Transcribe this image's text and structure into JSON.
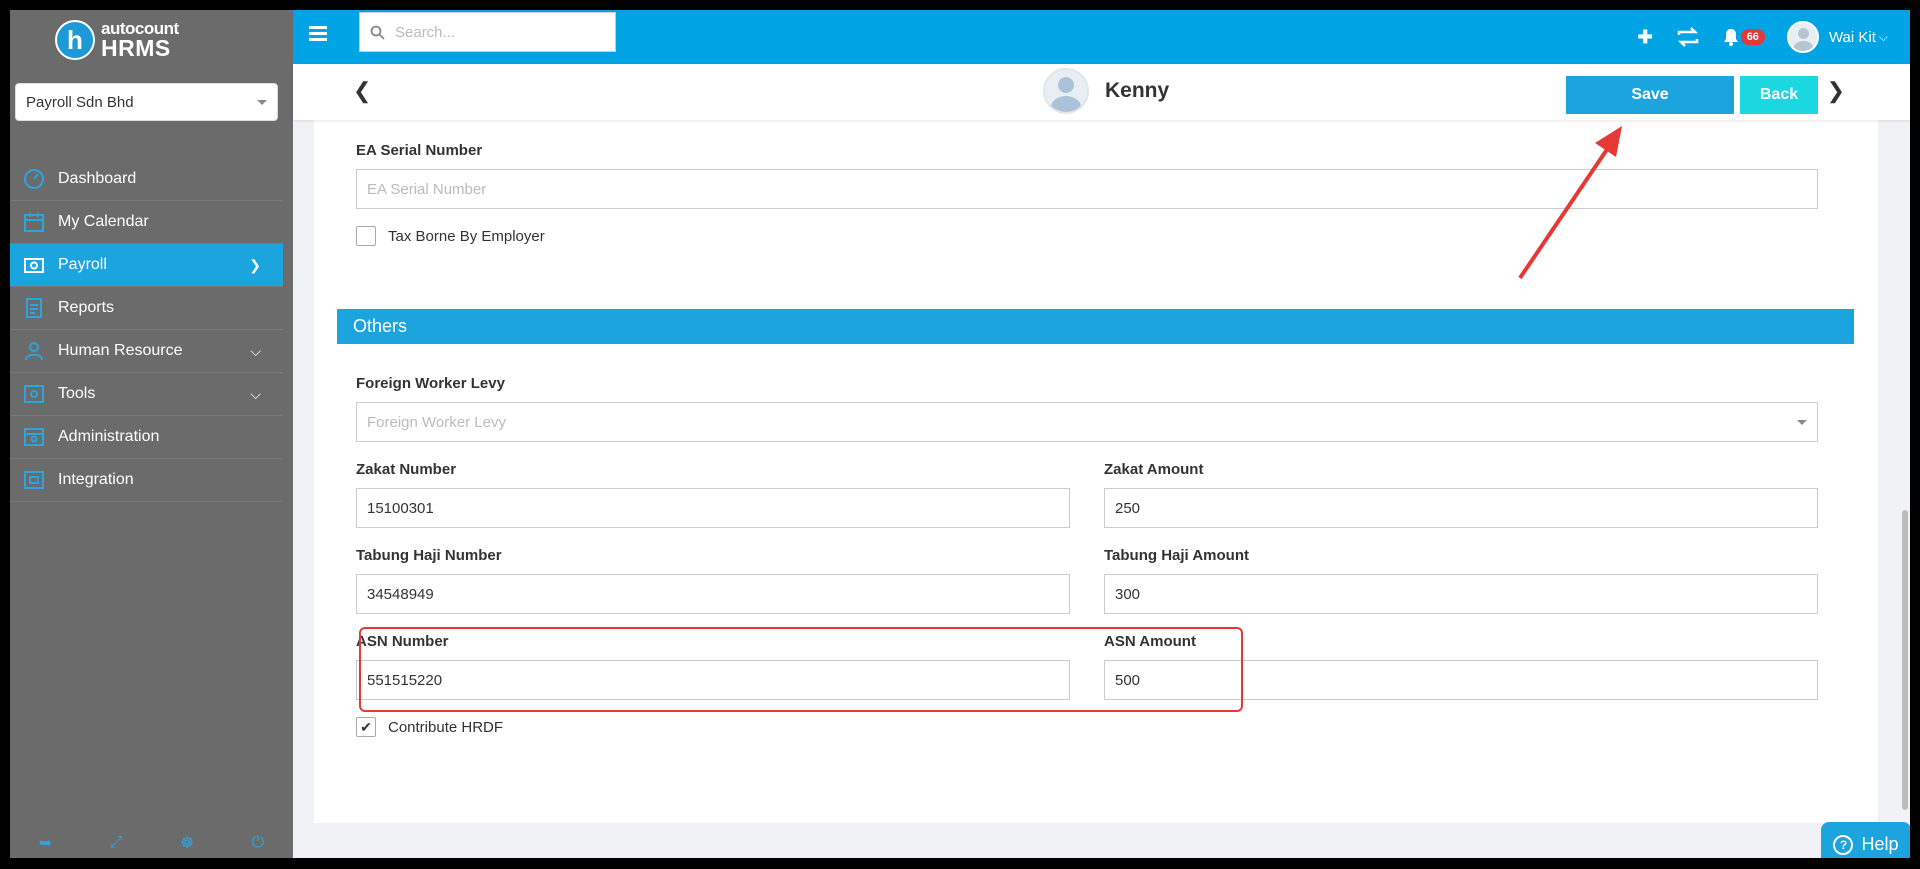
{
  "brand": {
    "mark": "h",
    "top": "autocount",
    "bottom": "HRMS"
  },
  "company_select": {
    "value": "Payroll Sdn Bhd"
  },
  "sidebar": {
    "items": [
      {
        "label": "Dashboard",
        "icon": "dashboard-icon"
      },
      {
        "label": "My Calendar",
        "icon": "calendar-icon"
      },
      {
        "label": "Payroll",
        "icon": "payroll-icon",
        "active": true
      },
      {
        "label": "Reports",
        "icon": "reports-icon"
      },
      {
        "label": "Human Resource",
        "icon": "human-resource-icon"
      },
      {
        "label": "Tools",
        "icon": "tools-icon"
      },
      {
        "label": "Administration",
        "icon": "administration-icon"
      },
      {
        "label": "Integration",
        "icon": "integration-icon"
      }
    ],
    "footer_icons": [
      "logout-icon",
      "fullscreen-icon",
      "language-icon",
      "power-icon"
    ]
  },
  "topbar": {
    "search_placeholder": "Search...",
    "notification_count": "66",
    "user_name": "Wai Kit"
  },
  "record": {
    "name": "Kenny",
    "save_label": "Save",
    "back_label": "Back"
  },
  "form": {
    "ea_serial": {
      "label": "EA Serial Number",
      "placeholder": "EA Serial Number",
      "value": ""
    },
    "tax_borne": {
      "label": "Tax Borne By Employer",
      "checked": false
    },
    "others_title": "Others",
    "foreign_worker_levy": {
      "label": "Foreign Worker Levy",
      "placeholder": "Foreign Worker Levy"
    },
    "zakat_number": {
      "label": "Zakat Number",
      "value": "15100301"
    },
    "zakat_amount": {
      "label": "Zakat Amount",
      "value": "250"
    },
    "tabung_haji_number": {
      "label": "Tabung Haji Number",
      "value": "34548949"
    },
    "tabung_haji_amount": {
      "label": "Tabung Haji Amount",
      "value": "300"
    },
    "asn_number": {
      "label": "ASN Number",
      "value": "551515220"
    },
    "asn_amount": {
      "label": "ASN Amount",
      "value": "500"
    },
    "contribute_hrdf": {
      "label": "Contribute HRDF",
      "checked": true
    }
  },
  "help": {
    "label": "Help"
  },
  "colors": {
    "primary": "#1ba4de",
    "topbar": "#00a4e4",
    "sidebar": "#6b6b6b",
    "back_button": "#1bd7e0",
    "annotation": "#e53935"
  }
}
